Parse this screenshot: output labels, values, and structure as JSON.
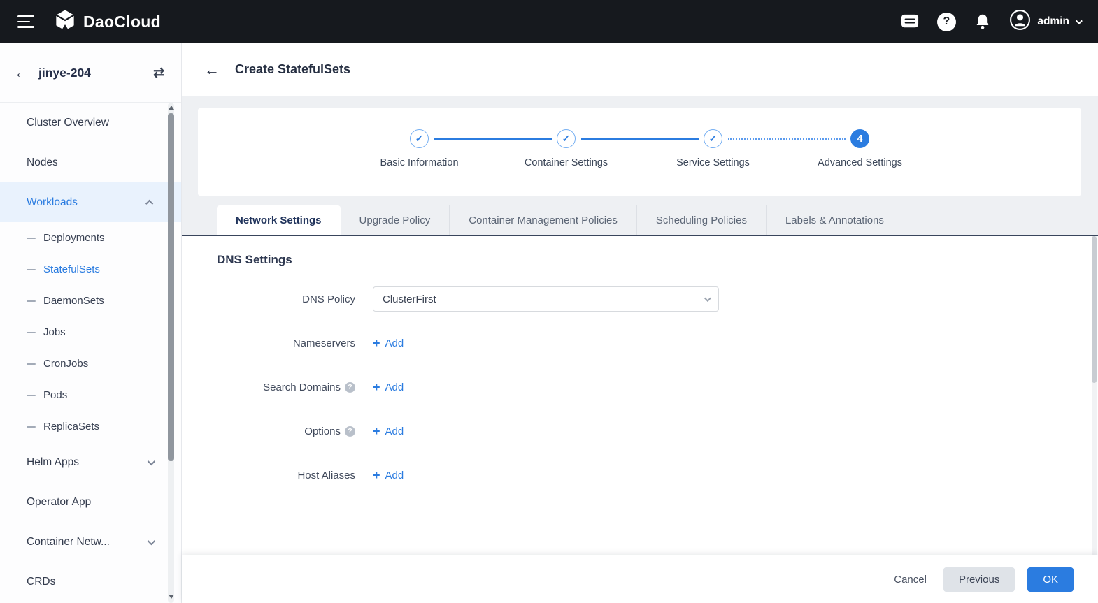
{
  "colors": {
    "primary_blue": "#2b7ce0",
    "topbar_bg": "#16191e",
    "active_item_bg": "#e9f2fd",
    "content_bg": "#eef0f3",
    "tab_underline": "#39455c",
    "previous_button_bg": "#dfe3e8"
  },
  "icons": {
    "back_arrow": "←",
    "swap": "⇄",
    "plus": "+",
    "question": "?",
    "check": "✓"
  },
  "topbar": {
    "brand": "DaoCloud",
    "user": {
      "name": "admin"
    }
  },
  "sidebar": {
    "cluster_name": "jinye-204",
    "items": [
      {
        "label": "Cluster Overview"
      },
      {
        "label": "Nodes"
      },
      {
        "label": "Workloads"
      },
      {
        "label": "Deployments"
      },
      {
        "label": "StatefulSets"
      },
      {
        "label": "DaemonSets"
      },
      {
        "label": "Jobs"
      },
      {
        "label": "CronJobs"
      },
      {
        "label": "Pods"
      },
      {
        "label": "ReplicaSets"
      },
      {
        "label": "Helm Apps"
      },
      {
        "label": "Operator App"
      },
      {
        "label": "Container Netw..."
      },
      {
        "label": "CRDs"
      }
    ]
  },
  "page": {
    "title": "Create StatefulSets",
    "steps": [
      {
        "label": "Basic Information",
        "state": "done"
      },
      {
        "label": "Container Settings",
        "state": "done"
      },
      {
        "label": "Service Settings",
        "state": "done"
      },
      {
        "label": "Advanced Settings",
        "state": "active",
        "number": "4"
      }
    ],
    "tabs": [
      {
        "label": "Network Settings",
        "active": true
      },
      {
        "label": "Upgrade Policy"
      },
      {
        "label": "Container Management Policies"
      },
      {
        "label": "Scheduling Policies"
      },
      {
        "label": "Labels & Annotations"
      }
    ],
    "section": {
      "title": "DNS Settings"
    },
    "form": {
      "dns_policy": {
        "label": "DNS Policy",
        "value": "ClusterFirst"
      },
      "nameservers": {
        "label": "Nameservers",
        "add": "Add"
      },
      "search_domains": {
        "label": "Search Domains",
        "add": "Add"
      },
      "options": {
        "label": "Options",
        "add": "Add"
      },
      "host_aliases": {
        "label": "Host Aliases",
        "add": "Add"
      }
    },
    "footer": {
      "cancel": "Cancel",
      "previous": "Previous",
      "ok": "OK"
    }
  }
}
